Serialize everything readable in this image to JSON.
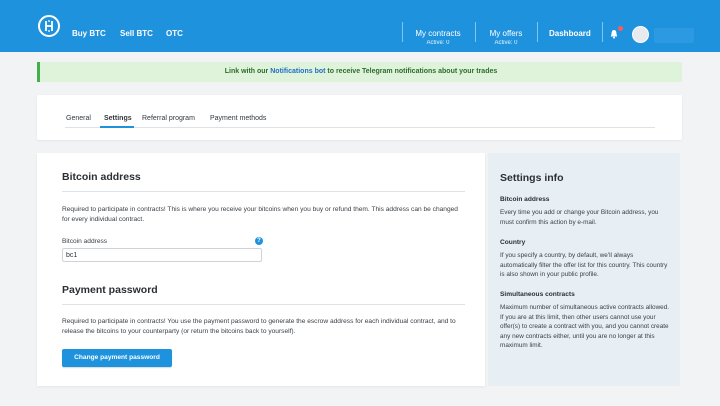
{
  "colors": {
    "primary": "#1f92de",
    "success_bg": "#dff3da",
    "success_border": "#42b14b",
    "panel_bg": "#e8eff4"
  },
  "nav": {
    "buy": "Buy BTC",
    "sell": "Sell BTC",
    "otc": "OTC",
    "contracts": {
      "label": "My contracts",
      "sub": "Active: 0"
    },
    "offers": {
      "label": "My offers",
      "sub": "Active: 0"
    },
    "dashboard": "Dashboard",
    "icons": [
      "logo-icon",
      "bell-icon",
      "avatar"
    ]
  },
  "notice": {
    "prefix": "Link with our ",
    "link": "Notifications bot",
    "suffix": " to receive Telegram notifications about your trades"
  },
  "tabs": [
    {
      "label": "General"
    },
    {
      "label": "Settings"
    },
    {
      "label": "Referral program"
    },
    {
      "label": "Payment methods"
    }
  ],
  "active_tab": "Settings",
  "bitcoin": {
    "title": "Bitcoin address",
    "description": "Required to participate in contracts! This is where you receive your bitcoins when you buy or refund them. This address can be changed for every individual contract.",
    "field_label": "Bitcoin address",
    "value": "bc1",
    "help": "?"
  },
  "payment": {
    "title": "Payment password",
    "description": "Required to participate in contracts! You use the payment password to generate the escrow address for each individual contract, and to release the bitcoins to your counterparty (or return the bitcoins back to yourself).",
    "button": "Change payment password"
  },
  "info": {
    "title": "Settings info",
    "items": [
      {
        "head": "Bitcoin address",
        "text": "Every time you add or change your Bitcoin address, you must confirm this action by e-mail."
      },
      {
        "head": "Country",
        "text": "If you specify a country, by default, we'll always automatically filter the offer list for this country. This country is also shown in your public profile."
      },
      {
        "head": "Simultaneous contracts",
        "text": "Maximum number of simultaneous active contracts allowed. If you are at this limit, then other users cannot use your offer(s) to create a contract with you, and you cannot create any new contracts either, until you are no longer at this maximum limit."
      }
    ]
  }
}
